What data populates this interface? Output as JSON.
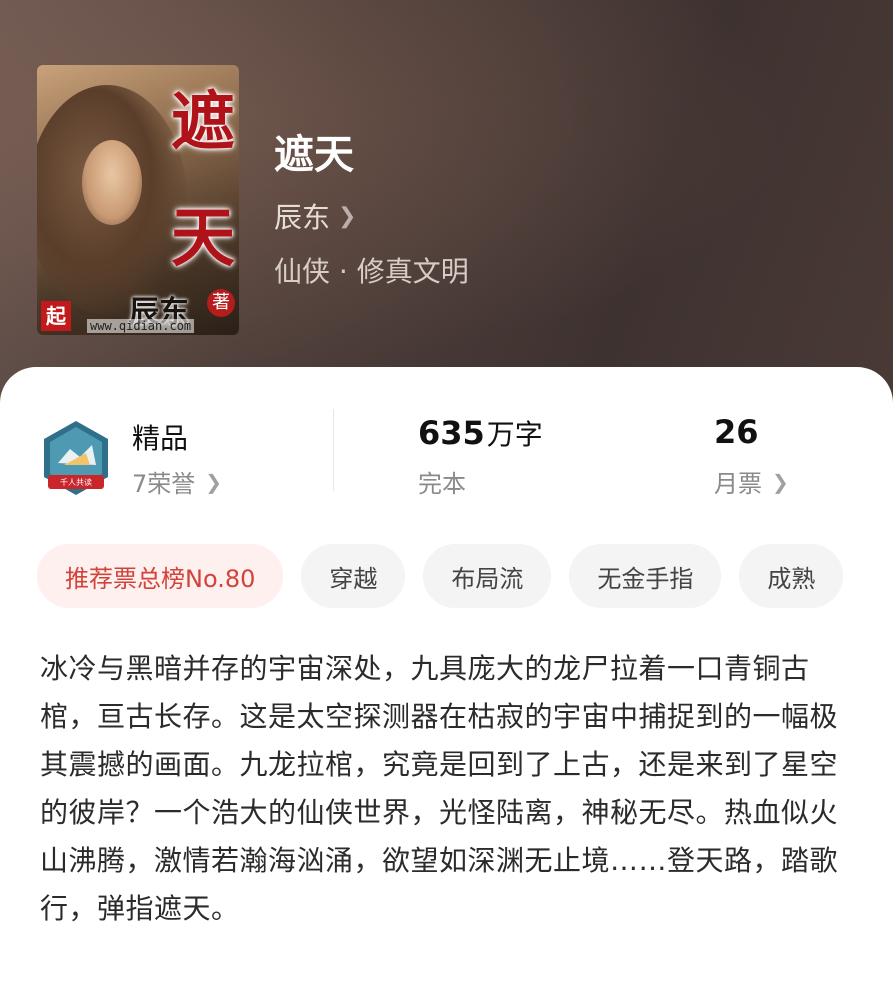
{
  "book": {
    "title": "遮天",
    "author": "辰东",
    "genre": "仙侠 · 修真文明"
  },
  "cover": {
    "title_char_1": "遮",
    "title_char_2": "天",
    "author_mark": "辰东",
    "author_seal": "著",
    "publisher_seal": "起",
    "site": "www.qidian.com"
  },
  "stats": {
    "quality": {
      "label": "精品",
      "honors": "7荣誉",
      "badge_text": "千人共读"
    },
    "words": {
      "value": "635",
      "unit": "万字",
      "status": "完本"
    },
    "votes": {
      "value": "26",
      "label": "月票"
    }
  },
  "tags": [
    "推荐票总榜No.80",
    "穿越",
    "布局流",
    "无金手指",
    "成熟"
  ],
  "description": "冰冷与黑暗并存的宇宙深处，九具庞大的龙尸拉着一口青铜古棺，亘古长存。这是太空探测器在枯寂的宇宙中捕捉到的一幅极其震撼的画面。九龙拉棺，究竟是回到了上古，还是来到了星空的彼岸？一个浩大的仙侠世界，光怪陆离，神秘无尽。热血似火山沸腾，激情若瀚海汹涌，欲望如深渊无止境……登天路，踏歌行，弹指遮天。",
  "colors": {
    "accent": "#d2433a",
    "rank_tag_bg": "#fdf0ef",
    "tag_bg": "#f4f4f4"
  }
}
